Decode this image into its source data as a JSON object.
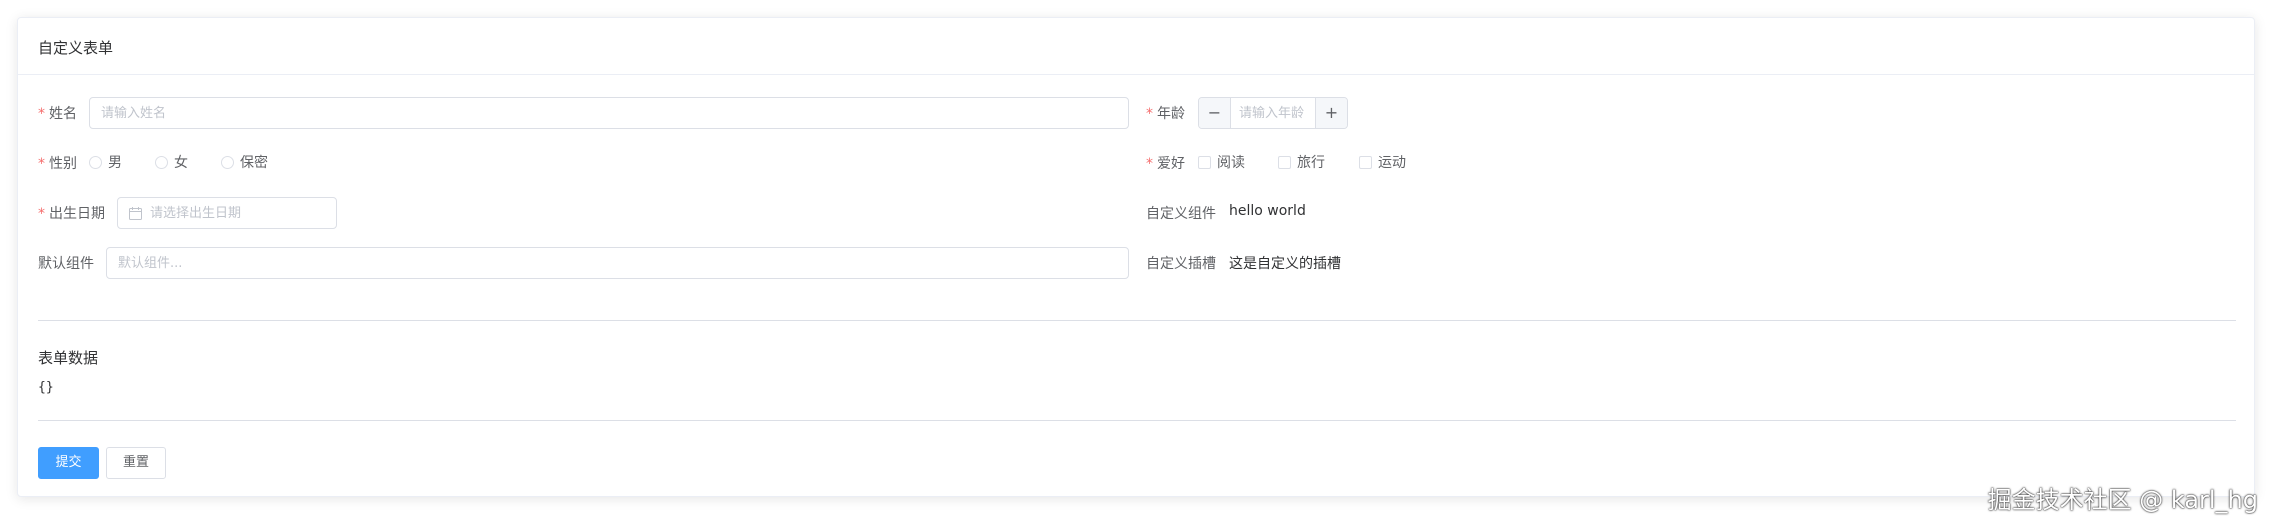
{
  "card": {
    "title": "自定义表单"
  },
  "form": {
    "name": {
      "label": "姓名",
      "placeholder": "请输入姓名"
    },
    "age": {
      "label": "年龄",
      "placeholder": "请输入年龄",
      "minus": "−",
      "plus": "+"
    },
    "gender": {
      "label": "性别",
      "options": [
        "男",
        "女",
        "保密"
      ]
    },
    "hobby": {
      "label": "爱好",
      "options": [
        "阅读",
        "旅行",
        "运动"
      ]
    },
    "birthday": {
      "label": "出生日期",
      "placeholder": "请选择出生日期"
    },
    "custom_component": {
      "label": "自定义组件",
      "value": "hello world"
    },
    "default_component": {
      "label": "默认组件",
      "placeholder": "默认组件..."
    },
    "custom_slot": {
      "label": "自定义插槽",
      "value": "这是自定义的插槽"
    },
    "required_mark": "*"
  },
  "data_section": {
    "title": "表单数据",
    "value": "{}"
  },
  "actions": {
    "submit": "提交",
    "reset": "重置"
  },
  "watermark": "掘金技术社区 @ karl_hg",
  "colors": {
    "primary": "#409eff",
    "required": "#f56c6c",
    "border": "#dcdfe6"
  }
}
